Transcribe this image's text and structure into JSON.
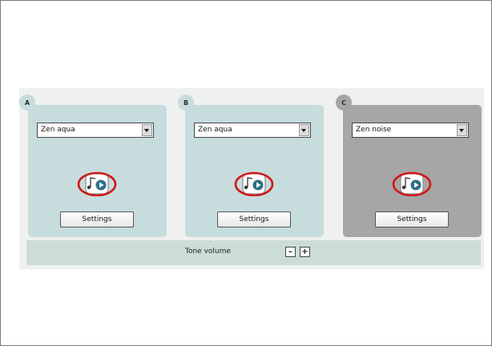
{
  "panels": [
    {
      "letter": "A",
      "sound": "Zen aqua",
      "settings_label": "Settings"
    },
    {
      "letter": "B",
      "sound": "Zen aqua",
      "settings_label": "Settings"
    },
    {
      "letter": "C",
      "sound": "Zen noise",
      "settings_label": "Settings"
    }
  ],
  "volume": {
    "label": "Tone volume",
    "minus": "–",
    "plus": "+"
  },
  "colors": {
    "panel_active": "#c7dcdc",
    "panel_inactive": "#a6a6a6",
    "highlight_circle": "#d01818",
    "play_button": "#2f6f86"
  }
}
